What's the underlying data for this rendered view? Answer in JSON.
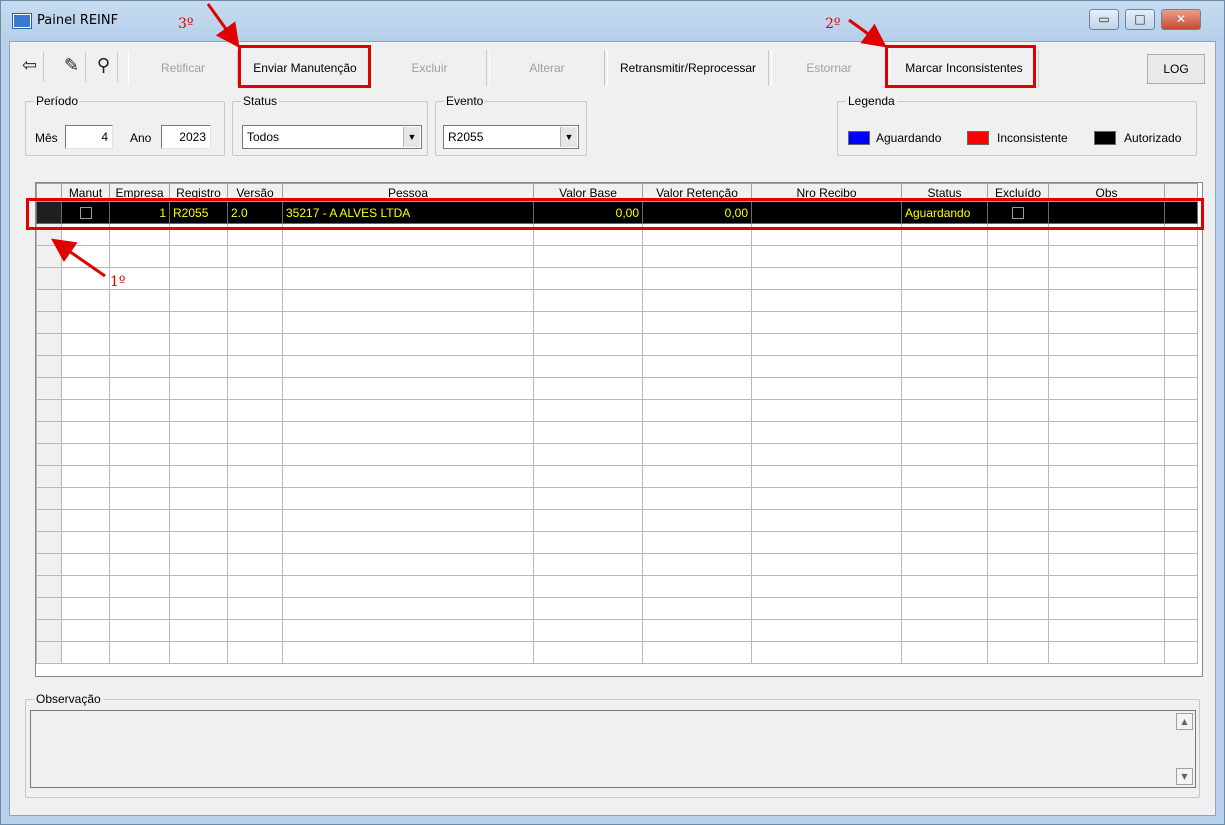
{
  "window": {
    "title": "Painel REINF",
    "minimize_glyph": "▭",
    "maximize_glyph": "□",
    "close_glyph": "✕"
  },
  "toolbar": {
    "icons": [
      "exit-icon",
      "eraser-icon",
      "binoculars-icon"
    ],
    "icon_glyphs": [
      "⇦",
      "✎",
      "⚲"
    ],
    "retificar": "Retificar",
    "enviar_manutencao": "Enviar Manutenção",
    "excluir": "Excluir",
    "alterar": "Alterar",
    "retransmitir": "Retransmitir/Reprocessar",
    "estornar": "Estornar",
    "marcar_inconsistentes": "Marcar Inconsistentes",
    "log": "LOG"
  },
  "annotations": {
    "first": "1º",
    "second": "2º",
    "third": "3º",
    "color": "#e00000"
  },
  "filters": {
    "periodo_label": "Período",
    "mes_label": "Mês",
    "mes_value": "4",
    "ano_label": "Ano",
    "ano_value": "2023",
    "status_label": "Status",
    "status_value": "Todos",
    "evento_label": "Evento",
    "evento_value": "R2055",
    "dropdown_glyph": "▼"
  },
  "legend": {
    "title": "Legenda",
    "items": [
      {
        "label": "Aguardando",
        "color": "#0000ff"
      },
      {
        "label": "Inconsistente",
        "color": "#ff0000"
      },
      {
        "label": "Autorizado",
        "color": "#000000"
      }
    ]
  },
  "grid": {
    "columns": [
      "Manut",
      "Empresa",
      "Registro",
      "Versão",
      "Pessoa",
      "Valor Base",
      "Valor Retenção",
      "Nro Recibo",
      "Status",
      "Excluído",
      "Obs"
    ],
    "rows": [
      {
        "empresa": "1",
        "registro": "R2055",
        "versao": "2.0",
        "pessoa": "35217 - A ALVES LTDA",
        "valor_base": "0,00",
        "valor_retencao": "0,00",
        "nro_recibo": "",
        "status": "Aguardando",
        "obs": ""
      }
    ],
    "selected_row_bg": "#000000",
    "selected_row_fg": "#ffff00"
  },
  "observacao": {
    "label": "Observação",
    "value": "",
    "scroll_up_glyph": "▲",
    "scroll_down_glyph": "▼"
  }
}
